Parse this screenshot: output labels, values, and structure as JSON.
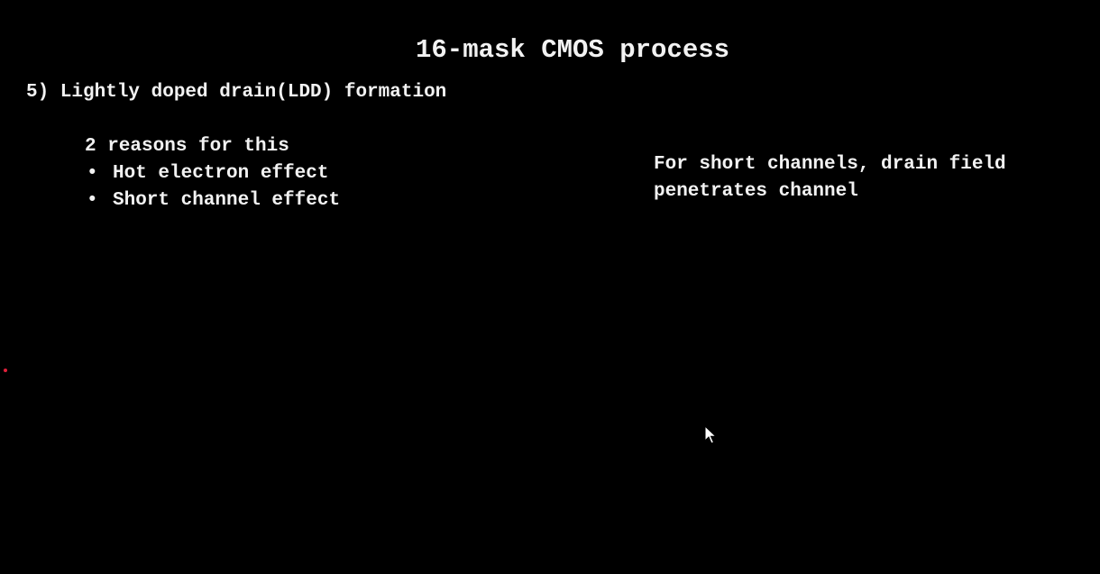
{
  "slide": {
    "title": "16-mask CMOS process",
    "section_heading": "5) Lightly doped drain(LDD) formation",
    "reasons_intro": "2 reasons for this",
    "reasons": [
      "Hot electron effect",
      "Short channel effect"
    ],
    "bullet_glyph": "•",
    "note": "For short channels, drain field penetrates channel"
  },
  "colors": {
    "background": "#000000",
    "text": "#f2f2f2",
    "laser_dot": "#e0203a"
  },
  "icons": {
    "cursor": "mouse-pointer-icon",
    "laser": "laser-pointer-dot-icon"
  }
}
